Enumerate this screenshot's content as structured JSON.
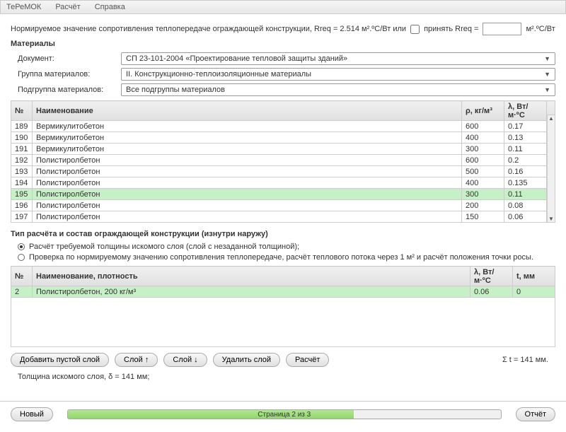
{
  "menu": {
    "item1": "ТеРеМОК",
    "item2": "Расчёт",
    "item3": "Справка"
  },
  "rreq": {
    "text": "Нормируемое значение сопротивления теплопередаче ограждающей конструкции, Rreq = 2.514 м².ºС/Вт или",
    "chk": "принять Rreq =",
    "unit": "м².ºС/Вт"
  },
  "materials_h": "Материалы",
  "doc": {
    "label": "Документ:",
    "value": "СП 23-101-2004 «Проектирование тепловой защиты зданий»"
  },
  "grp": {
    "label": "Группа материалов:",
    "value": "II. Конструкционно-теплоизоляционные материалы"
  },
  "sub": {
    "label": "Подгруппа материалов:",
    "value": "Все подгруппы материалов"
  },
  "t1": {
    "h_no": "№",
    "h_name": "Наименование",
    "h_rho": "ρ, кг/м³",
    "h_l": "λ, Вт/м·ºС",
    "rows": [
      {
        "no": "189",
        "name": "Вермикулитобетон",
        "rho": "600",
        "l": "0.17"
      },
      {
        "no": "190",
        "name": "Вермикулитобетон",
        "rho": "400",
        "l": "0.13"
      },
      {
        "no": "191",
        "name": "Вермикулитобетон",
        "rho": "300",
        "l": "0.11"
      },
      {
        "no": "192",
        "name": "Полистиролбетон",
        "rho": "600",
        "l": "0.2"
      },
      {
        "no": "193",
        "name": "Полистиролбетон",
        "rho": "500",
        "l": "0.16"
      },
      {
        "no": "194",
        "name": "Полистиролбетон",
        "rho": "400",
        "l": "0.135"
      },
      {
        "no": "195",
        "name": "Полистиролбетон",
        "rho": "300",
        "l": "0.11",
        "hl": true
      },
      {
        "no": "196",
        "name": "Полистиролбетон",
        "rho": "200",
        "l": "0.08"
      },
      {
        "no": "197",
        "name": "Полистиролбетон",
        "rho": "150",
        "l": "0.06"
      }
    ]
  },
  "calc_h": "Тип расчёта и состав ограждающей конструкции (изнутри наружу)",
  "r1": "Расчёт требуемой толщины искомого слоя (слой с незаданной толщиной);",
  "r2": "Проверка по нормируемому значению сопротивления теплопередаче, расчёт теплового потока через 1 м² и расчёт положения точки росы.",
  "t2": {
    "h_no": "№",
    "h_name": "Наименование, плотность",
    "h_l": "λ, Вт/м·ºС",
    "h_t": "t, мм",
    "rows": [
      {
        "no": "2",
        "name": "Полистиролбетон, 200 кг/м³",
        "l": "0.06",
        "t": "0",
        "hl": true
      }
    ]
  },
  "btns": {
    "add": "Добавить пустой слой",
    "up": "Слой ↑",
    "down": "Слой ↓",
    "del": "Удалить слой",
    "calc": "Расчёт"
  },
  "sumt": "Σ t = 141 мм.",
  "thick": "Толщина искомого слоя, δ = 141 мм;",
  "footer": {
    "new": "Новый",
    "page": "Страница 2 из 3",
    "report": "Отчёт"
  }
}
